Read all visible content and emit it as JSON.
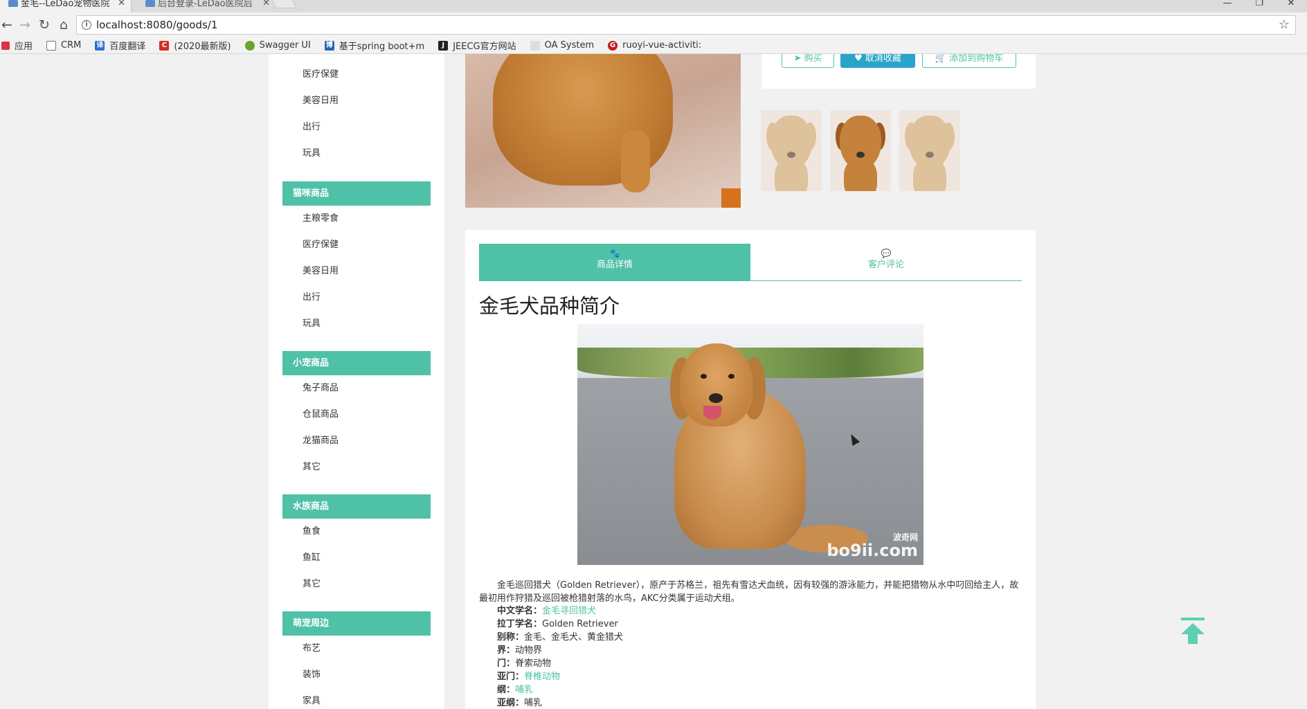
{
  "browser": {
    "tabs": [
      {
        "title": "金毛--LeDao宠物医院"
      },
      {
        "title": "后台登录-LeDao医院后"
      }
    ],
    "url": "localhost:8080/goods/1",
    "bookmarks": [
      {
        "label": "应用",
        "icon": "apps-grid-icon"
      },
      {
        "label": "CRM",
        "icon": "page-icon"
      },
      {
        "label": "百度翻译",
        "icon": "baidu-translate-icon"
      },
      {
        "label": "(2020最新版)",
        "icon": "csdn-icon"
      },
      {
        "label": "Swagger UI",
        "icon": "swagger-icon"
      },
      {
        "label": "基于spring boot+m",
        "icon": "blog-icon"
      },
      {
        "label": "JEECG官方网站",
        "icon": "jeecg-icon"
      },
      {
        "label": "OA System",
        "icon": "page-icon"
      },
      {
        "label": "ruoyi-vue-activiti: ",
        "icon": "gitee-icon"
      }
    ]
  },
  "sidebar": {
    "top_items": [
      "医疗保健",
      "美容日用",
      "出行",
      "玩具"
    ],
    "groups": [
      {
        "title": "猫咪商品",
        "items": [
          "主粮零食",
          "医疗保健",
          "美容日用",
          "出行",
          "玩具"
        ]
      },
      {
        "title": "小宠商品",
        "items": [
          "兔子商品",
          "仓鼠商品",
          "龙猫商品",
          "其它"
        ]
      },
      {
        "title": "水族商品",
        "items": [
          "鱼食",
          "鱼缸",
          "其它"
        ]
      },
      {
        "title": "萌宠周边",
        "items": [
          "布艺",
          "装饰",
          "家具"
        ]
      }
    ]
  },
  "product": {
    "buy_label": "购买",
    "favorite_label": "取消收藏",
    "cart_label": "添加到购物车",
    "tabs": [
      {
        "label": "商品详情",
        "icon": "paw-icon"
      },
      {
        "label": "客户评论",
        "icon": "comment-icon"
      }
    ],
    "intro_title": "金毛犬品种简介",
    "description": "金毛巡回猎犬（Golden Retriever），原产于苏格兰，祖先有雪达犬血统，因有较强的游泳能力，并能把猎物从水中叼回给主人，故最初用作狩猎及巡回被枪猎射落的水鸟，AKC分类属于运动犬组。",
    "watermark": "bo9ii.com",
    "watermark_sub": "波奇网",
    "info": [
      {
        "label": "中文学名：",
        "value": "金毛寻回猎犬",
        "link": true
      },
      {
        "label": "拉丁学名：",
        "value": "Golden Retriever",
        "link": false
      },
      {
        "label": "别称：",
        "value": "金毛、金毛犬、黄金猎犬",
        "link": false
      },
      {
        "label": "界：",
        "value": "动物界",
        "link": false
      },
      {
        "label": "门：",
        "value": "脊索动物",
        "link": false
      },
      {
        "label": "亚门：",
        "value": "脊椎动物",
        "link": true
      },
      {
        "label": "纲：",
        "value": "哺乳",
        "link": true
      },
      {
        "label": "亚纲：",
        "value": "哺乳",
        "link": false
      }
    ]
  },
  "colors": {
    "accent": "#4fc1a6",
    "favorite_button": "#2aa4c8"
  }
}
